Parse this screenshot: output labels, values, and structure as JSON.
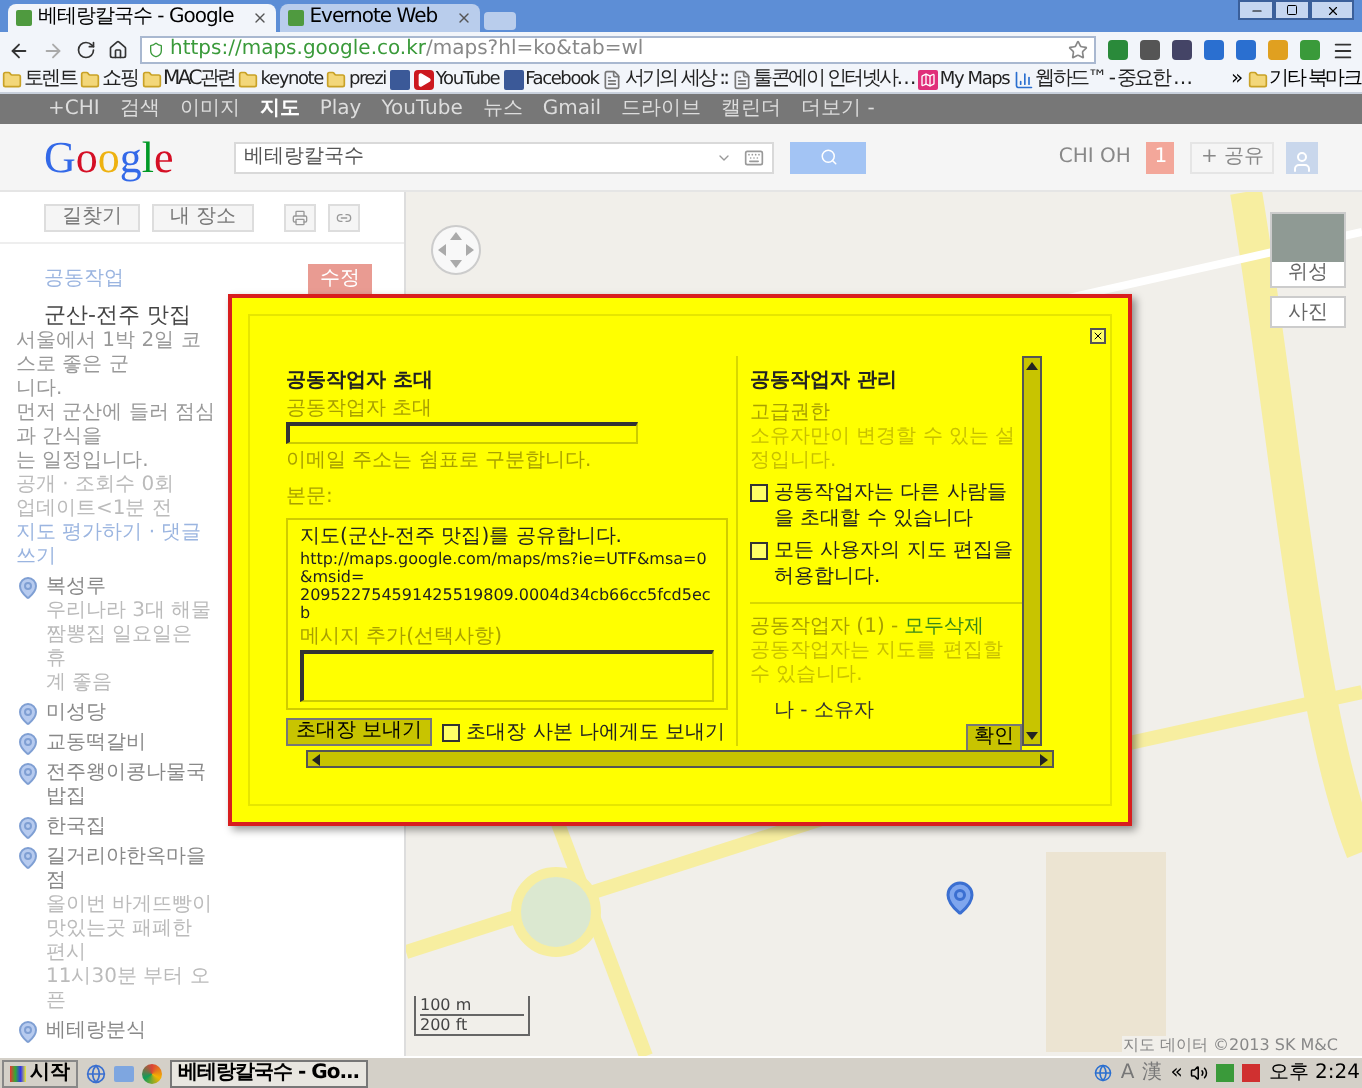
{
  "browser": {
    "tabs": [
      {
        "title": "베테랑칼국수 - Google",
        "selected": true
      },
      {
        "title": "Evernote Web",
        "selected": false
      }
    ],
    "url": {
      "host": "https://maps.google.co.kr",
      "path": "/maps?hl=ko&tab=wl"
    },
    "bookmarks": [
      {
        "kind": "folder",
        "label": "토렌트"
      },
      {
        "kind": "folder",
        "label": "쇼핑"
      },
      {
        "kind": "folder",
        "label": "MAC관련"
      },
      {
        "kind": "folder",
        "label": "keynote"
      },
      {
        "kind": "folder",
        "label": "prezi"
      },
      {
        "kind": "square"
      },
      {
        "kind": "video",
        "label": "YouTube"
      },
      {
        "kind": "square",
        "label": "Facebook"
      },
      {
        "kind": "page",
        "label": "서기의 세상 ::"
      },
      {
        "kind": "page",
        "label": "툴콘에이 인터넷사…"
      },
      {
        "kind": "map",
        "label": "My Maps"
      },
      {
        "kind": "chart",
        "label": "웹하드™ - 중요한 …"
      }
    ],
    "overflow": "»",
    "other": "기타 북마크"
  },
  "google_bar": [
    {
      "label": "+CHI",
      "selected": false
    },
    {
      "label": "검색",
      "selected": false
    },
    {
      "label": "이미지",
      "selected": false
    },
    {
      "label": "지도",
      "selected": true
    },
    {
      "label": "Play",
      "selected": false
    },
    {
      "label": "YouTube",
      "selected": false
    },
    {
      "label": "뉴스",
      "selected": false
    },
    {
      "label": "Gmail",
      "selected": false
    },
    {
      "label": "드라이브",
      "selected": false
    },
    {
      "label": "캘린더",
      "selected": false
    },
    {
      "label": "더보기 -",
      "selected": false
    }
  ],
  "header": {
    "logo": "Google",
    "search": "베테랑칼국수",
    "user": "CHI OH",
    "notifications": "1",
    "share": "+ 공유"
  },
  "sidebar": {
    "buttons": [
      "길찾기",
      "내 장소"
    ],
    "collab_link": "공동작업",
    "edit": "수정",
    "title": "군산-전주 맛집",
    "description": [
      "서울에서 1박 2일 코스로 좋은 군",
      "니다.",
      "먼저 군산에 들러 점심과 간식을",
      "는 일정입니다."
    ],
    "meta": [
      "공개 · 조회수 0회",
      "업데이트<1분 전"
    ],
    "links": "지도 평가하기 · 댓글 쓰기",
    "places": [
      {
        "name": "복성루",
        "notes": [
          "우리나라 3대 해물 짬뽕집 일요일은 휴",
          "계 좋음"
        ]
      },
      {
        "name": "미성당"
      },
      {
        "name": "교동떡갈비"
      },
      {
        "name": "전주왱이콩나물국밥집"
      },
      {
        "name": "한국집"
      },
      {
        "name": "길거리야한옥마을점",
        "notes": [
          "올이번 바게뜨빵이 맛있는곳 패폐한 편시",
          "11시30분 부터 오픈"
        ]
      },
      {
        "name": "베테랑분식"
      }
    ]
  },
  "map": {
    "views": [
      "위성",
      "사진"
    ],
    "scale": [
      "100 m",
      "200 ft"
    ],
    "copyright": "지도 데이터 ©2013 SK M&C"
  },
  "dialog": {
    "invite": {
      "title": "공동작업자 초대",
      "field_label": "공동작업자 초대",
      "hint": "이메일 주소는 쉼표로 구분합니다.",
      "body_label": "본문:",
      "body": [
        "지도(군산-전주 맛집)를 공유합니다.",
        "http://maps.google.com/maps/ms?ie=UTF&msa=0&msid=",
        "209522754591425519809.0004d34cb66cc5fcd5ecb"
      ],
      "message_label": "메시지 추가(선택사항)",
      "send": "초대장 보내기",
      "copy": {
        "label": "초대장 사본 나에게도 보내기",
        "checked": false
      }
    },
    "manage": {
      "title": "공동작업자 관리",
      "perm_title": "고급권한",
      "perm_note": "소유자만이 변경할 수 있는 설정입니다.",
      "options": [
        {
          "label": "공동작업자는 다른 사람들을 초대할 수 있습니다",
          "checked": false
        },
        {
          "label": "모든 사용자의 지도 편집을 허용합니다.",
          "checked": false
        }
      ],
      "collab_heading": "공동작업자 (1) -",
      "remove_all": "모두삭제",
      "collab_note": "공동작업자는 지도를 편집할 수 있습니다.",
      "member": "나 - 소유자",
      "ok": "확인"
    }
  },
  "taskbar": {
    "start": "시작",
    "task": "베테랑칼국수 - Go...",
    "ime": [
      "A",
      "漢"
    ],
    "expand": "«",
    "clock": "오후 2:24"
  }
}
